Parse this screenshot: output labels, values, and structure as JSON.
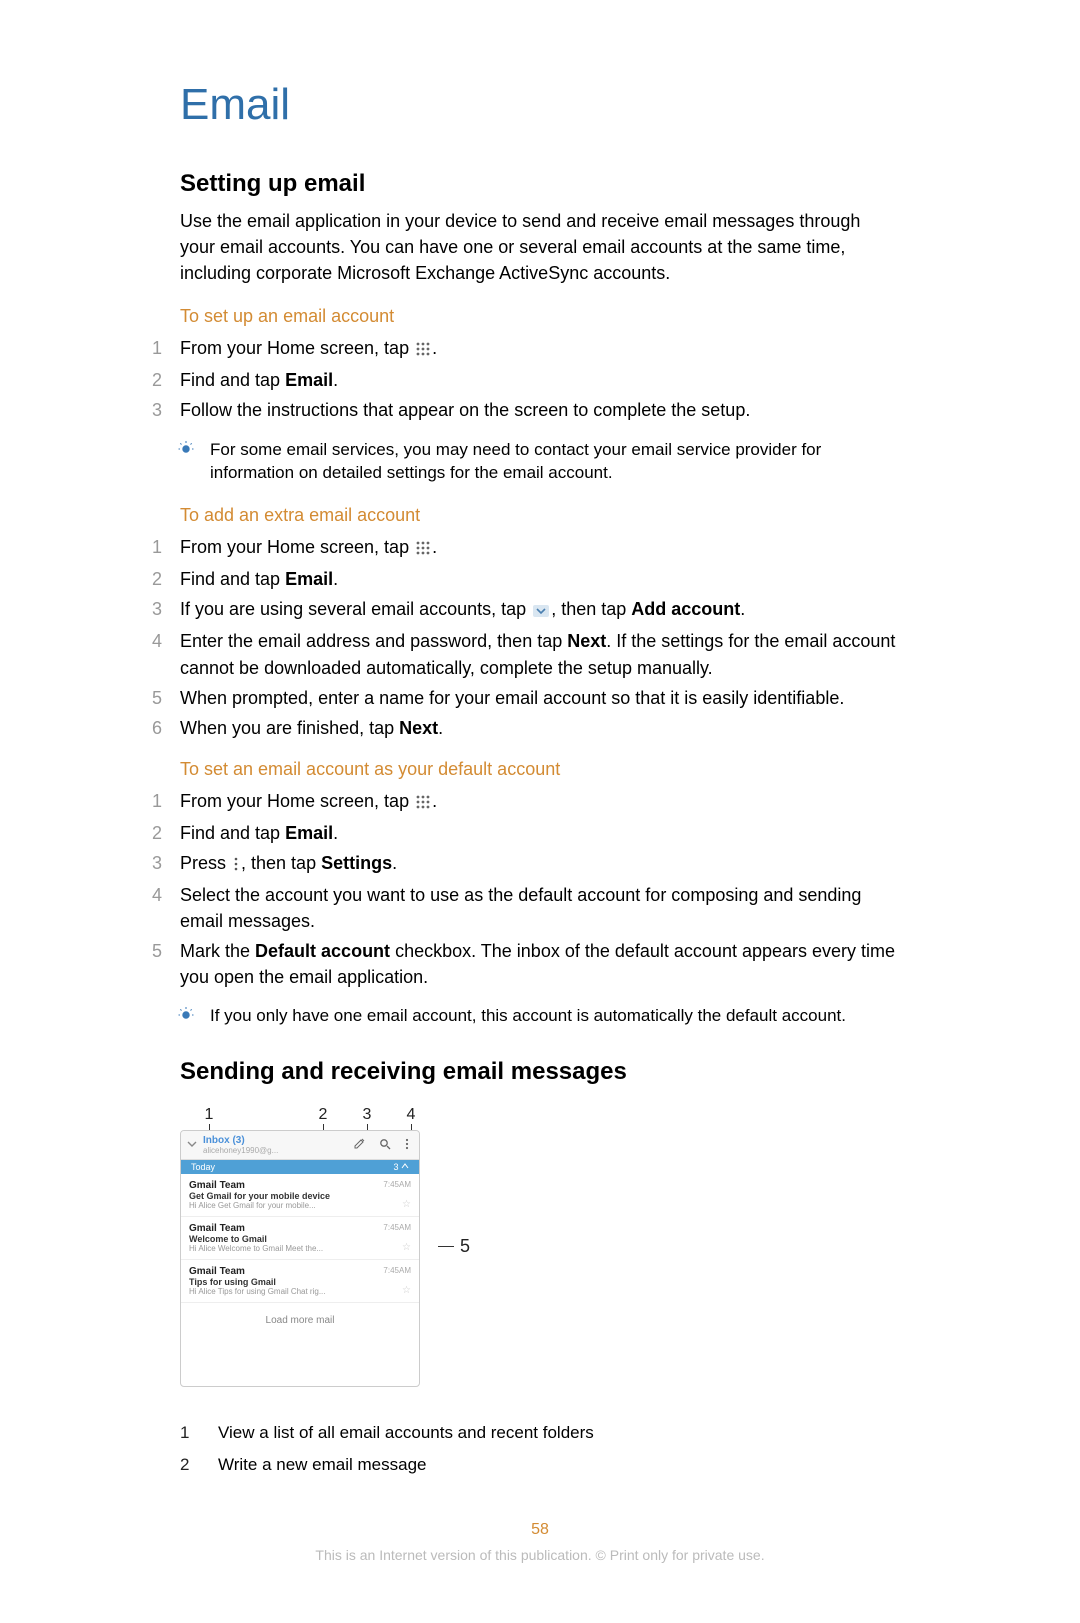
{
  "title": "Email",
  "section1": {
    "heading": "Setting up email",
    "intro": "Use the email application in your device to send and receive email messages through your email accounts. You can have one or several email accounts at the same time, including corporate Microsoft Exchange ActiveSync accounts.",
    "sub1": {
      "title": "To set up an email account",
      "steps": {
        "s1a": "From your Home screen, tap ",
        "s1b": ".",
        "s2a": "Find and tap ",
        "s2b": "Email",
        "s2c": ".",
        "s3": "Follow the instructions that appear on the screen to complete the setup."
      },
      "tip": "For some email services, you may need to contact your email service provider for information on detailed settings for the email account."
    },
    "sub2": {
      "title": "To add an extra email account",
      "steps": {
        "s1a": "From your Home screen, tap ",
        "s1b": ".",
        "s2a": "Find and tap ",
        "s2b": "Email",
        "s2c": ".",
        "s3a": "If you are using several email accounts, tap ",
        "s3b": ", then tap ",
        "s3c": "Add account",
        "s3d": ".",
        "s4a": "Enter the email address and password, then tap ",
        "s4b": "Next",
        "s4c": ". If the settings for the email account cannot be downloaded automatically, complete the setup manually.",
        "s5": "When prompted, enter a name for your email account so that it is easily identifiable.",
        "s6a": "When you are finished, tap ",
        "s6b": "Next",
        "s6c": "."
      }
    },
    "sub3": {
      "title": "To set an email account as your default account",
      "steps": {
        "s1a": "From your Home screen, tap ",
        "s1b": ".",
        "s2a": "Find and tap ",
        "s2b": "Email",
        "s2c": ".",
        "s3a": "Press ",
        "s3b": ", then tap ",
        "s3c": "Settings",
        "s3d": ".",
        "s4": "Select the account you want to use as the default account for composing and sending email messages.",
        "s5a": "Mark the ",
        "s5b": "Default account",
        "s5c": " checkbox. The inbox of the default account appears every time you open the email application."
      },
      "tip": "If you only have one email account, this account is automatically the default account."
    }
  },
  "section2": {
    "heading": "Sending and receiving email messages",
    "callouts": {
      "c1": "1",
      "c2": "2",
      "c3": "3",
      "c4": "4",
      "c5": "5"
    },
    "screenshot": {
      "inbox_label": "Inbox (3)",
      "inbox_sub": "alicehoney1990@g...",
      "today": "Today",
      "today_count": "3 ",
      "items": [
        {
          "sender": "Gmail Team",
          "subject": "Get Gmail for your mobile device",
          "preview": "Hi Alice Get Gmail for your mobile...",
          "time": "7:45AM"
        },
        {
          "sender": "Gmail Team",
          "subject": "Welcome to Gmail",
          "preview": "Hi Alice Welcome to Gmail Meet the...",
          "time": "7:45AM"
        },
        {
          "sender": "Gmail Team",
          "subject": "Tips for using Gmail",
          "preview": "Hi Alice Tips for using Gmail Chat rig...",
          "time": "7:45AM"
        }
      ],
      "load_more": "Load more mail"
    },
    "legend": {
      "r1n": "1",
      "r1t": "View a list of all email accounts and recent folders",
      "r2n": "2",
      "r2t": "Write a new email message"
    }
  },
  "footer": {
    "page": "58",
    "note": "This is an Internet version of this publication. © Print only for private use."
  }
}
